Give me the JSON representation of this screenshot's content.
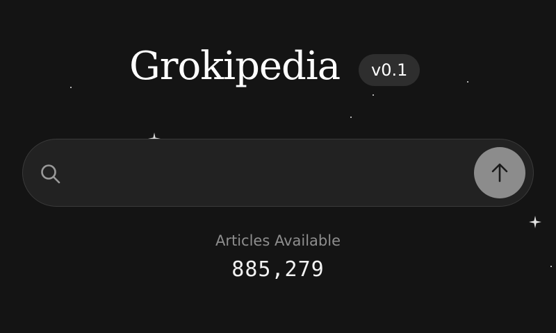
{
  "header": {
    "title": "Grokipedia",
    "version": "v0.1"
  },
  "search": {
    "value": "",
    "placeholder": "",
    "submit_icon": "arrow-up-icon",
    "search_icon": "search-icon"
  },
  "stats": {
    "label": "Articles Available",
    "count": "885,279"
  },
  "colors": {
    "background": "#141414",
    "search_bar": "#222222",
    "submit_button": "#8c8c8c",
    "badge": "#2e2e2e",
    "muted_text": "#8e8e8e"
  }
}
